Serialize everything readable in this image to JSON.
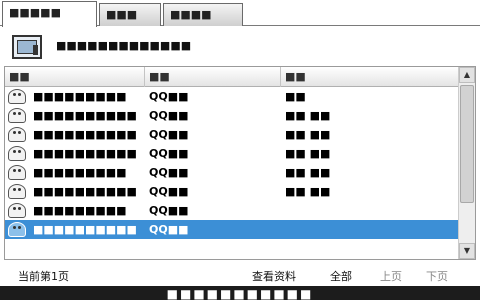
{
  "tabs": [
    {
      "label": "■■■■■",
      "active": true
    },
    {
      "label": "■■■",
      "active": false
    },
    {
      "label": "■■■■",
      "active": false
    }
  ],
  "info": {
    "text": "■■■■■■■■■■■■■"
  },
  "list": {
    "columns": [
      "■■",
      "■■",
      "■■"
    ],
    "rows": [
      {
        "number": "■■■■■■■■■",
        "name": "QQ■■",
        "location": "■■"
      },
      {
        "number": "■■■■■■■■■■",
        "name": "QQ■■",
        "location": "■■ ■■"
      },
      {
        "number": "■■■■■■■■■■",
        "name": "QQ■■",
        "location": "■■ ■■"
      },
      {
        "number": "■■■■■■■■■■",
        "name": "QQ■■",
        "location": "■■ ■■"
      },
      {
        "number": "■■■■■■■■■",
        "name": "QQ■■",
        "location": "■■ ■■"
      },
      {
        "number": "■■■■■■■■■■",
        "name": "QQ■■",
        "location": "■■ ■■"
      },
      {
        "number": "■■■■■■■■■",
        "name": "QQ■■",
        "location": ""
      },
      {
        "number": "■■■■■■■■■■",
        "name": "QQ■■",
        "location": "",
        "selected": true
      }
    ]
  },
  "bottom": {
    "page_label": "当前第1页",
    "details_label": "查看资料",
    "all_label": "全部",
    "prev_label": "上页",
    "next_label": "下页"
  },
  "caption": {
    "text": "■■■■■■■■■■■"
  },
  "scrollbar": {
    "up_glyph": "▲",
    "down_glyph": "▼"
  },
  "colors": {
    "selection": "#3c8fd6",
    "disabled_link": "#888888"
  }
}
